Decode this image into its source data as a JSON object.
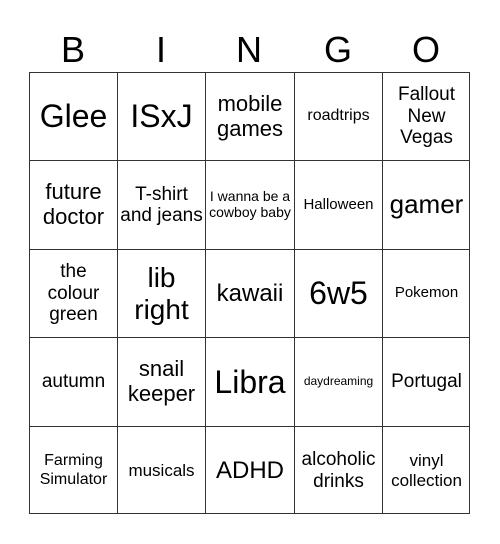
{
  "header": [
    "B",
    "I",
    "N",
    "G",
    "O"
  ],
  "cells": [
    [
      {
        "text": "Glee",
        "size": "s32"
      },
      {
        "text": "ISxJ",
        "size": "s32"
      },
      {
        "text": "mobile games",
        "size": "s22"
      },
      {
        "text": "roadtrips",
        "size": "s16"
      },
      {
        "text": "Fallout New Vegas",
        "size": "s19"
      }
    ],
    [
      {
        "text": "future doctor",
        "size": "s22"
      },
      {
        "text": "T-shirt and jeans",
        "size": "s19"
      },
      {
        "text": "I wanna be a cowboy baby",
        "size": "s14"
      },
      {
        "text": "Halloween",
        "size": "s15"
      },
      {
        "text": "gamer",
        "size": "s26"
      }
    ],
    [
      {
        "text": "the colour green",
        "size": "s19"
      },
      {
        "text": "lib right",
        "size": "s28"
      },
      {
        "text": "kawaii",
        "size": "s24"
      },
      {
        "text": "6w5",
        "size": "s32"
      },
      {
        "text": "Pokemon",
        "size": "s15"
      }
    ],
    [
      {
        "text": "autumn",
        "size": "s19"
      },
      {
        "text": "snail keeper",
        "size": "s22"
      },
      {
        "text": "Libra",
        "size": "s32"
      },
      {
        "text": "daydreaming",
        "size": "s12"
      },
      {
        "text": "Portugal",
        "size": "s19"
      }
    ],
    [
      {
        "text": "Farming Simulator",
        "size": "s16"
      },
      {
        "text": "musicals",
        "size": "s17"
      },
      {
        "text": "ADHD",
        "size": "s24"
      },
      {
        "text": "alcoholic drinks",
        "size": "s19"
      },
      {
        "text": "vinyl collection",
        "size": "s17"
      }
    ]
  ]
}
